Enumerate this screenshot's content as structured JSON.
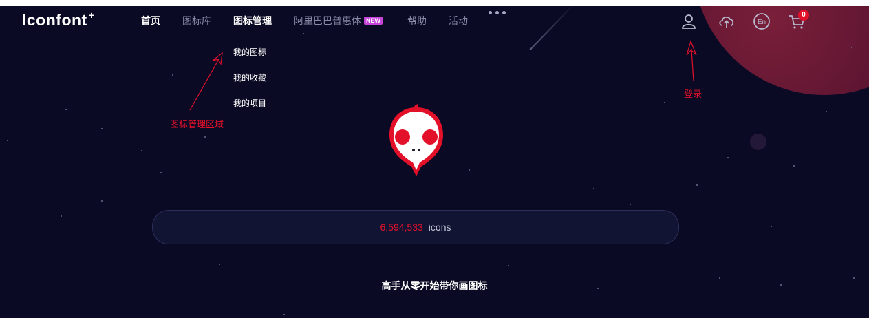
{
  "brand": {
    "logo_text": "Iconfont",
    "logo_mark": "+"
  },
  "nav": {
    "items": [
      {
        "label": "首页",
        "state": "white"
      },
      {
        "label": "图标库",
        "state": "dim"
      },
      {
        "label": "图标管理",
        "state": "active"
      },
      {
        "label": "阿里巴巴普惠体",
        "state": "dim",
        "badge": "NEW"
      },
      {
        "label": "帮助",
        "state": "dim"
      },
      {
        "label": "活动",
        "state": "dim"
      }
    ],
    "more_icon": "more-dots-icon"
  },
  "dropdown": {
    "items": [
      "我的图标",
      "我的收藏",
      "我的项目"
    ]
  },
  "toolbar": {
    "icons": [
      "user-icon",
      "cloud-upload-icon",
      "language-en-icon",
      "cart-icon"
    ],
    "cart_count": "0"
  },
  "annotations": {
    "manage_area": "图标管理区域",
    "login": "登录",
    "color": "#e3102a"
  },
  "search": {
    "count": "6,594,533",
    "suffix": "icons"
  },
  "tagline": "高手从零开始带你画图标",
  "colors": {
    "background": "#0b0a24",
    "accent": "#e3102a",
    "badge": "#c545d8"
  }
}
